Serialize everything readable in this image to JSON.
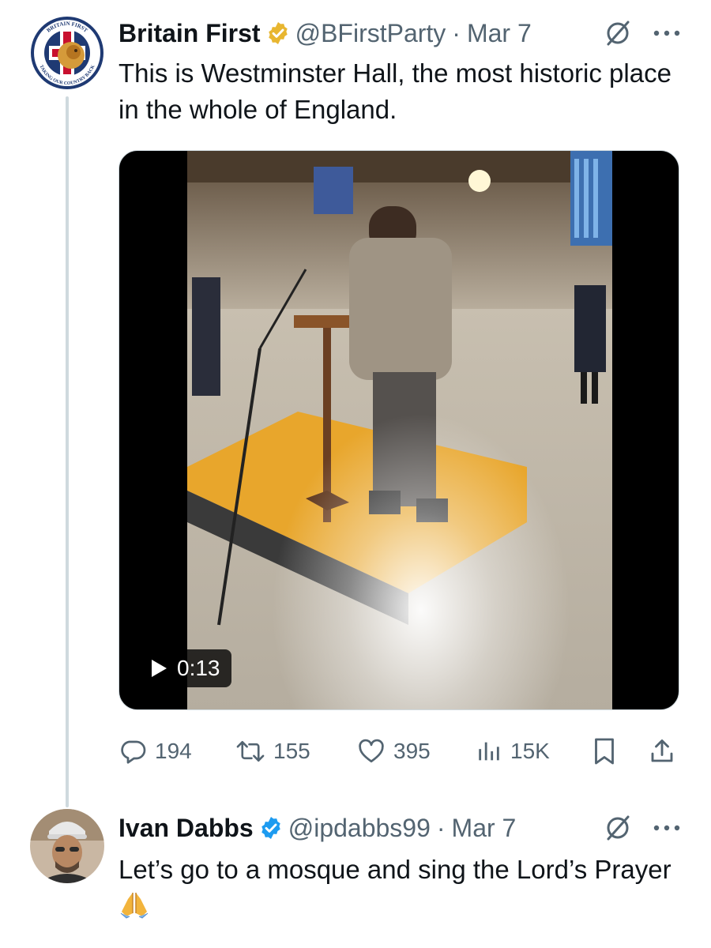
{
  "thread": {
    "tweet1": {
      "author_name": "Britain First",
      "handle": "@BFirstParty",
      "separator": "·",
      "date": "Mar 7",
      "text": "This is Westminster Hall, the most historic place in the whole of England.",
      "avatar_text_top": "BRITAIN FIRST",
      "avatar_text_bottom": "TAKING OUR COUNTRY BACK",
      "video": {
        "duration": "0:13"
      },
      "stats": {
        "replies": "194",
        "retweets": "155",
        "likes": "395",
        "views": "15K"
      },
      "badge_color": "#e8b630"
    },
    "tweet2": {
      "author_name": "Ivan Dabbs",
      "handle": "@ipdabbs99",
      "separator": "·",
      "date": "Mar 7",
      "text": "Let’s go to a mosque and sing the Lord’s Prayer",
      "emoji": "🙏",
      "badge_color": "#1d9bf0"
    }
  },
  "icons": {
    "verified_gold": "gold-checkmark-badge-icon",
    "verified_blue": "blue-checkmark-badge-icon",
    "grok": "grok-icon",
    "more": "more-dots-icon",
    "reply": "reply-bubble-icon",
    "retweet": "retweet-icon",
    "like": "heart-icon",
    "views": "views-bar-chart-icon",
    "bookmark": "bookmark-icon",
    "share": "share-icon",
    "play": "play-icon"
  },
  "colors": {
    "text_primary": "#0f1419",
    "text_secondary": "#536471",
    "thread_line": "#cfd9de"
  }
}
